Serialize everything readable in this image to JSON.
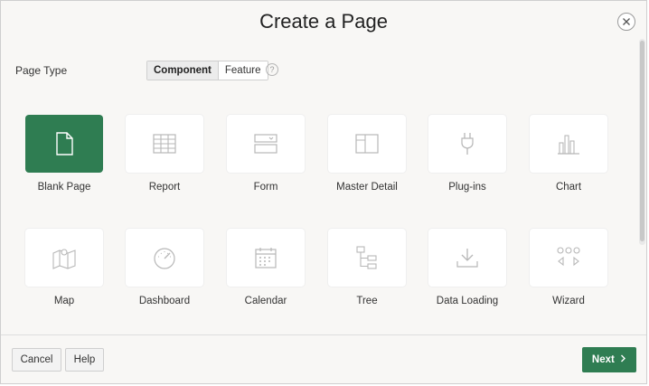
{
  "dialog": {
    "title": "Create a Page",
    "close_icon": "close-icon"
  },
  "page_type": {
    "label": "Page Type",
    "options": [
      "Component",
      "Feature"
    ],
    "selected": "Component",
    "help_icon": "help-icon",
    "help_glyph": "?"
  },
  "tiles": [
    {
      "label": "Blank Page",
      "icon": "blank-page-icon",
      "selected": true
    },
    {
      "label": "Report",
      "icon": "report-grid-icon",
      "selected": false
    },
    {
      "label": "Form",
      "icon": "form-icon",
      "selected": false
    },
    {
      "label": "Master Detail",
      "icon": "master-detail-icon",
      "selected": false
    },
    {
      "label": "Plug-ins",
      "icon": "plug-icon",
      "selected": false
    },
    {
      "label": "Chart",
      "icon": "bar-chart-icon",
      "selected": false
    },
    {
      "label": "Map",
      "icon": "map-icon",
      "selected": false
    },
    {
      "label": "Dashboard",
      "icon": "gauge-icon",
      "selected": false
    },
    {
      "label": "Calendar",
      "icon": "calendar-icon",
      "selected": false
    },
    {
      "label": "Tree",
      "icon": "tree-icon",
      "selected": false
    },
    {
      "label": "Data Loading",
      "icon": "download-icon",
      "selected": false
    },
    {
      "label": "Wizard",
      "icon": "wizard-icon",
      "selected": false
    }
  ],
  "footer": {
    "cancel_label": "Cancel",
    "help_label": "Help",
    "next_label": "Next",
    "next_icon": "chevron-right-icon"
  },
  "colors": {
    "accent": "#2f7d52",
    "background": "#f8f7f5",
    "icon_gray": "#b7b7b7"
  }
}
